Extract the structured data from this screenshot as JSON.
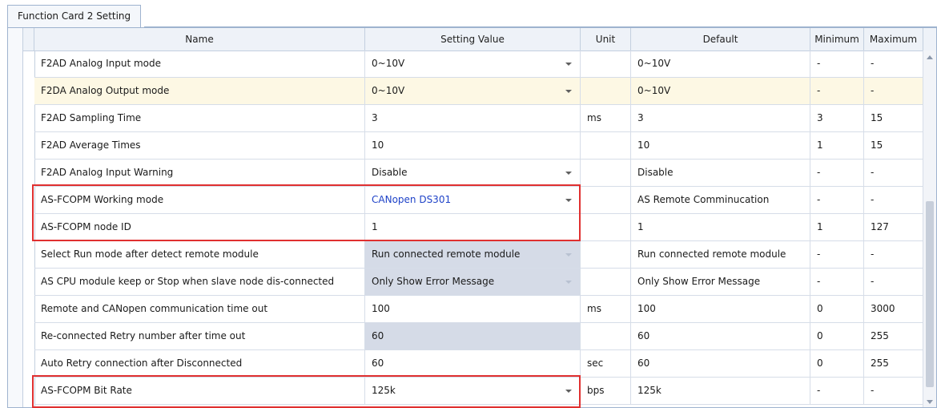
{
  "tab": {
    "label": "Function Card 2 Setting"
  },
  "columns": {
    "name": "Name",
    "setting_value": "Setting Value",
    "unit": "Unit",
    "default": "Default",
    "minimum": "Minimum",
    "maximum": "Maximum"
  },
  "rows": [
    {
      "name": "F2AD Analog Input mode",
      "value": "0~10V",
      "unit": "",
      "default": "0~10V",
      "min": "-",
      "max": "-"
    },
    {
      "name": "F2DA Analog Output mode",
      "value": "0~10V",
      "unit": "",
      "default": "0~10V",
      "min": "-",
      "max": "-"
    },
    {
      "name": "F2AD Sampling Time",
      "value": "3",
      "unit": "ms",
      "default": "3",
      "min": "3",
      "max": "15"
    },
    {
      "name": "F2AD Average Times",
      "value": "10",
      "unit": "",
      "default": "10",
      "min": "1",
      "max": "15"
    },
    {
      "name": "F2AD Analog Input Warning",
      "value": "Disable",
      "unit": "",
      "default": "Disable",
      "min": "-",
      "max": "-"
    },
    {
      "name": "AS-FCOPM Working mode",
      "value": "CANopen DS301",
      "unit": "",
      "default": "AS Remote Comminucation",
      "min": "-",
      "max": "-"
    },
    {
      "name": "AS-FCOPM node ID",
      "value": "1",
      "unit": "",
      "default": "1",
      "min": "1",
      "max": "127"
    },
    {
      "name": "Select Run mode after detect remote module",
      "value": "Run connected remote module",
      "unit": "",
      "default": "Run connected remote module",
      "min": "-",
      "max": "-"
    },
    {
      "name": "AS CPU module keep or Stop when slave node dis-connected",
      "value": "Only Show Error Message",
      "unit": "",
      "default": "Only Show Error Message",
      "min": "-",
      "max": "-"
    },
    {
      "name": "Remote and CANopen communication time out",
      "value": "100",
      "unit": "ms",
      "default": "100",
      "min": "0",
      "max": "3000"
    },
    {
      "name": "Re-connected Retry number after time out",
      "value": "60",
      "unit": "",
      "default": "60",
      "min": "0",
      "max": "255"
    },
    {
      "name": "Auto Retry connection after Disconnected",
      "value": "60",
      "unit": "sec",
      "default": "60",
      "min": "0",
      "max": "255"
    },
    {
      "name": "AS-FCOPM Bit Rate",
      "value": "125k",
      "unit": "bps",
      "default": "125k",
      "min": "-",
      "max": "-"
    }
  ],
  "colors": {
    "highlight_row": "#fdf8e4",
    "disabled_cell": "#d5dbe7",
    "changed_value": "#1f43c8",
    "annotation_box": "#e03030"
  }
}
